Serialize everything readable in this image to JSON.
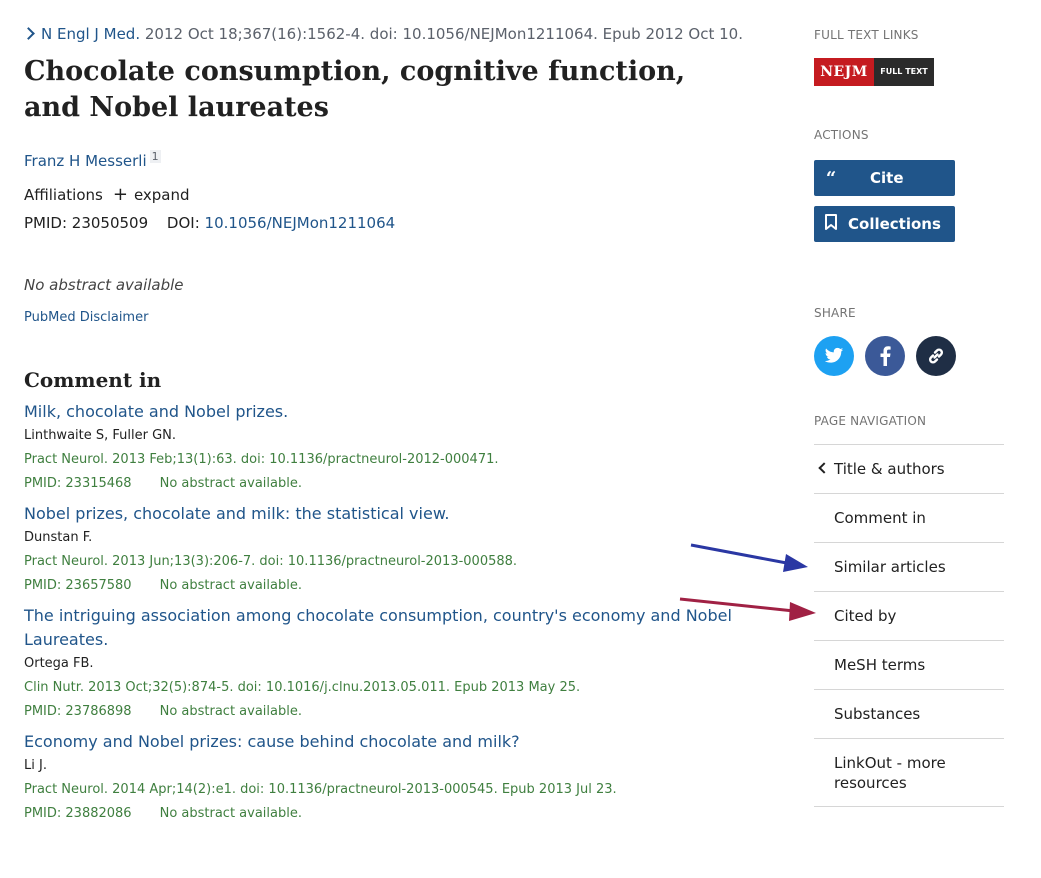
{
  "citation": {
    "journal": "N Engl J Med.",
    "details": "2012 Oct 18;367(16):1562-4. doi: 10.1056/NEJMon1211064. Epub 2012 Oct 10."
  },
  "article": {
    "title": "Chocolate consumption, cognitive function, and Nobel laureates",
    "author": "Franz H Messerli",
    "author_affil_num": "1",
    "affiliations_label": "Affiliations",
    "expand_label": "expand",
    "pmid_label": "PMID: 23050509",
    "doi_label": "DOI:",
    "doi_value": "10.1056/NEJMon1211064",
    "no_abstract": "No abstract available",
    "disclaimer": "PubMed Disclaimer"
  },
  "comments": {
    "heading": "Comment in",
    "items": [
      {
        "title": "Milk, chocolate and Nobel prizes.",
        "authors": "Linthwaite S, Fuller GN.",
        "ref": "Pract Neurol. 2013 Feb;13(1):63. doi: 10.1136/practneurol-2012-000471.",
        "pmid": "PMID: 23315468",
        "note": "No abstract available."
      },
      {
        "title": "Nobel prizes, chocolate and milk: the statistical view.",
        "authors": "Dunstan F.",
        "ref": "Pract Neurol. 2013 Jun;13(3):206-7. doi: 10.1136/practneurol-2013-000588.",
        "pmid": "PMID: 23657580",
        "note": "No abstract available."
      },
      {
        "title": "The intriguing association among chocolate consumption, country's economy and Nobel Laureates.",
        "authors": "Ortega FB.",
        "ref": "Clin Nutr. 2013 Oct;32(5):874-5. doi: 10.1016/j.clnu.2013.05.011. Epub 2013 May 25.",
        "pmid": "PMID: 23786898",
        "note": "No abstract available."
      },
      {
        "title": "Economy and Nobel prizes: cause behind chocolate and milk?",
        "authors": "Li J.",
        "ref": "Pract Neurol. 2014 Apr;14(2):e1. doi: 10.1136/practneurol-2013-000545. Epub 2013 Jul 23.",
        "pmid": "PMID: 23882086",
        "note": "No abstract available."
      }
    ]
  },
  "sidebar": {
    "full_text_label": "FULL TEXT LINKS",
    "nejm_logo_text": "NEJM",
    "nejm_badge_text": "FULL TEXT",
    "actions_label": "ACTIONS",
    "cite_label": "Cite",
    "collections_label": "Collections",
    "share_label": "SHARE",
    "page_nav_label": "PAGE NAVIGATION",
    "nav": [
      "Title & authors",
      "Comment in",
      "Similar articles",
      "Cited by",
      "MeSH terms",
      "Substances",
      "LinkOut - more resources"
    ]
  },
  "annotations": {
    "arrow1_color": "#2a37a3",
    "arrow2_color": "#a02144"
  },
  "colors": {
    "link": "#20558a",
    "ref_green": "#3f7f3f",
    "twitter": "#1da1f2",
    "facebook": "#3b5998",
    "permalink": "#1f2e45",
    "nejm_red": "#c51b20"
  }
}
